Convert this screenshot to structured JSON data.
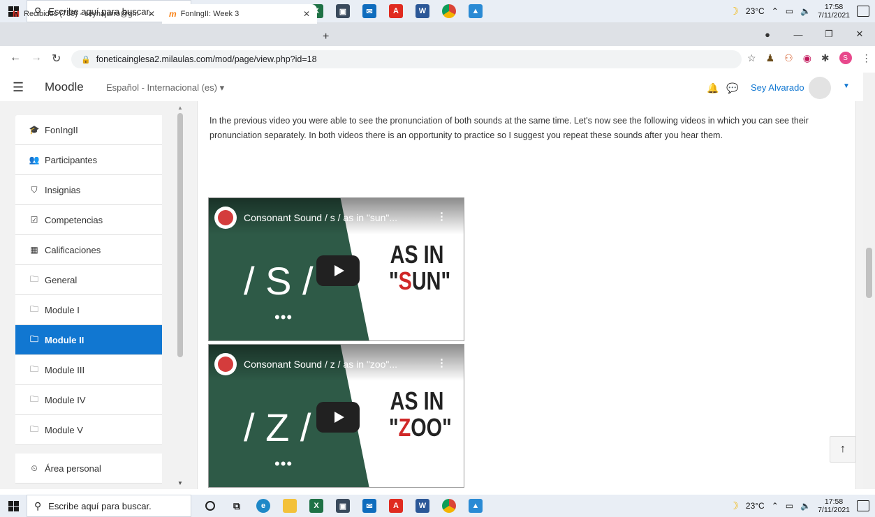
{
  "taskbar": {
    "search_placeholder": "Escribe aquí para buscar.",
    "temperature": "23°C",
    "time": "17:58",
    "date": "7/11/2021"
  },
  "tabs": [
    {
      "icon": "gmail-icon",
      "label": "Recibidos (789) - seynajarro@gm"
    },
    {
      "icon": "moodle-icon",
      "label": "FonIngII: Week 3"
    }
  ],
  "address": {
    "url": "foneticainglesa2.milaulas.com/mod/page/view.php?id=18"
  },
  "moodle": {
    "brand": "Moodle",
    "language": "Español - Internacional (es) ▾",
    "user": "Sey Alvarado"
  },
  "drawer": {
    "items": [
      {
        "icon": "graduation-cap-icon",
        "glyph": "🎓",
        "label": "FonIngII"
      },
      {
        "icon": "users-icon",
        "glyph": "👥",
        "label": "Participantes"
      },
      {
        "icon": "shield-icon",
        "glyph": "⛉",
        "label": "Insignias"
      },
      {
        "icon": "checkbox-icon",
        "glyph": "☑",
        "label": "Competencias"
      },
      {
        "icon": "table-icon",
        "glyph": "▦",
        "label": "Calificaciones"
      },
      {
        "icon": "folder-icon",
        "glyph": "🗀",
        "label": "General"
      },
      {
        "icon": "folder-icon",
        "glyph": "🗀",
        "label": "Module I"
      },
      {
        "icon": "folder-icon",
        "glyph": "🗀",
        "label": "Module II",
        "active": true
      },
      {
        "icon": "folder-icon",
        "glyph": "🗀",
        "label": "Module III"
      },
      {
        "icon": "folder-icon",
        "glyph": "🗀",
        "label": "Module IV"
      },
      {
        "icon": "folder-icon",
        "glyph": "🗀",
        "label": "Module V"
      }
    ],
    "personal": {
      "icon": "dashboard-icon",
      "glyph": "⏲",
      "label": "Área personal"
    }
  },
  "content": {
    "paragraph": "In the previous video you were able to see the pronunciation of both sounds at the same time. Let's now see the following videos in which you can see their pronunciation separately. In both videos there is an opportunity to practice so I suggest you repeat these sounds after you hear them."
  },
  "videos": [
    {
      "title": "Consonant Sound / s / as in \"sun\"...",
      "sound": "/ S /",
      "as_in": "AS IN",
      "word_prefix": "\"",
      "word_red": "S",
      "word_rest": "UN\""
    },
    {
      "title": "Consonant Sound / z / as in \"zoo\"...",
      "sound": "/ Z /",
      "as_in": "AS IN",
      "word_prefix": "\"",
      "word_red": "Z",
      "word_rest": "OO\""
    }
  ],
  "colors": {
    "accent": "#1177d1",
    "video_green": "#2e5a47",
    "red": "#d02828"
  }
}
